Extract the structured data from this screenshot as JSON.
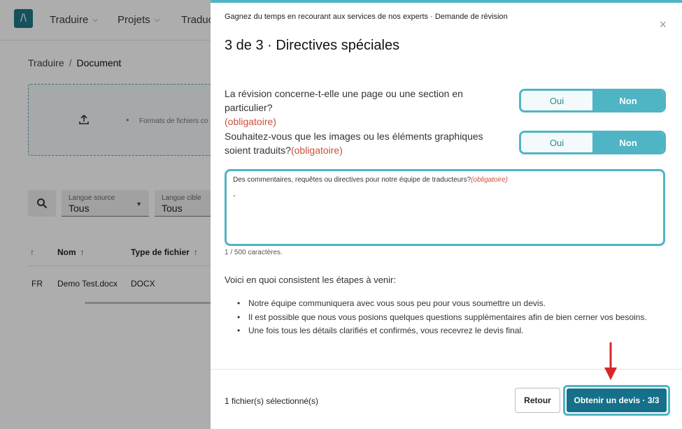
{
  "topbar": {
    "logo": "/\\",
    "nav": [
      {
        "label": "Traduire"
      },
      {
        "label": "Projets"
      },
      {
        "label": "Traduc"
      }
    ]
  },
  "breadcrumb": {
    "parent": "Traduire",
    "separator": "/",
    "current": "Document"
  },
  "upload": {
    "formats_text": "Formats de fichiers co"
  },
  "filters": {
    "source": {
      "label": "Langue source",
      "value": "Tous"
    },
    "target": {
      "label": "Langue cible",
      "value": "Tous"
    }
  },
  "table": {
    "headers": [
      {
        "label": "",
        "arrow": "↑"
      },
      {
        "label": "Nom",
        "arrow": "↑"
      },
      {
        "label": "Type de fichier",
        "arrow": "↑"
      }
    ],
    "rows": [
      {
        "lang": "FR",
        "name": "Demo Test.docx",
        "type": "DOCX"
      }
    ]
  },
  "modal": {
    "subtitle": "Gagnez du temps en recourant aux services de nos experts · Demande de révision",
    "close_icon": "×",
    "title": "3 de 3 · Directives spéciales",
    "questions": [
      {
        "text": "La révision concerne-t-elle une page ou une section en particulier?",
        "required": "(obligatoire)",
        "yes": "Oui",
        "no": "Non",
        "selected": "Non"
      },
      {
        "text": "Souhaitez-vous que les images ou les éléments graphiques soient traduits?",
        "required": "(obligatoire)",
        "yes": "Oui",
        "no": "Non",
        "selected": "Non"
      }
    ],
    "comments": {
      "label": "Des commentaires, requêtes ou directives pour notre équipe de traducteurs?",
      "required": "(obligatoire)",
      "value": "."
    },
    "char_count": "1 / 500 caractères.",
    "steps_intro": "Voici en quoi consistent les étapes à venir:",
    "steps": [
      "Notre équipe communiquera avec vous sous peu pour vous soumettre un devis.",
      "Il est possible que nous vous posions quelques questions supplémentaires afin de bien cerner vos besoins.",
      "Une fois tous les détails clarifiés et confirmés, vous recevrez le devis final."
    ],
    "footer": {
      "files_selected": "1 fichier(s) sélectionné(s)",
      "back_label": "Retour",
      "submit_label": "Obtenir un devis · 3/3"
    }
  },
  "colors": {
    "accent": "#4fb5c4",
    "primary_button": "#16708a",
    "required": "#c8503c",
    "annotation_arrow": "#d62828"
  }
}
